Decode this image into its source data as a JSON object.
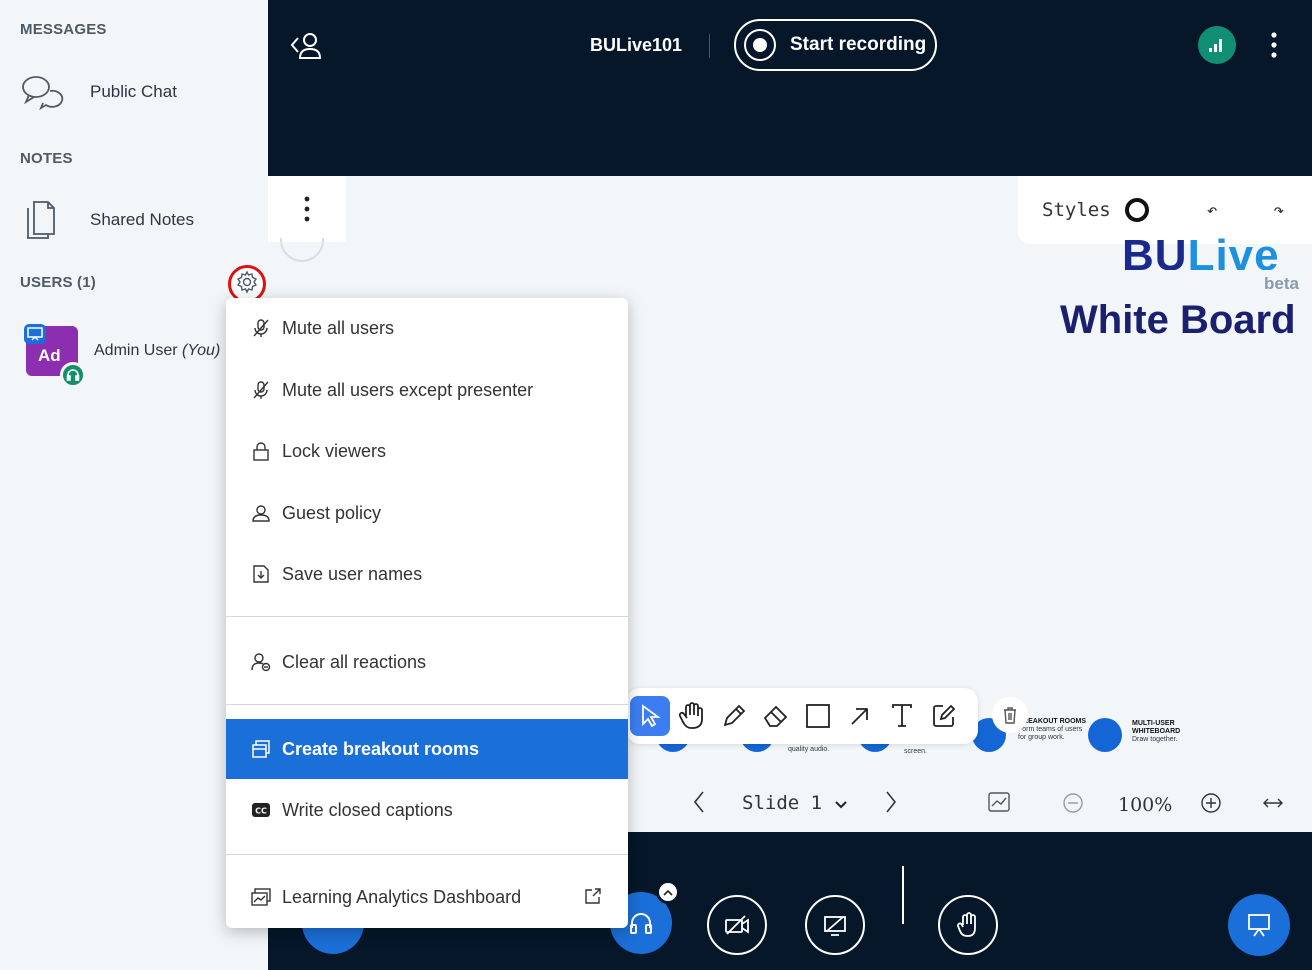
{
  "sidebar": {
    "messages_title": "MESSAGES",
    "public_chat": "Public Chat",
    "notes_title": "NOTES",
    "shared_notes": "Shared Notes",
    "users_title": "USERS (1)",
    "user": {
      "initials": "Ad",
      "name": "Admin User",
      "you_suffix": "(You)"
    }
  },
  "topbar": {
    "meeting_name": "BULive101",
    "record_label": "Start recording"
  },
  "presentation": {
    "styles_label": "Styles",
    "logo_bu": "BU",
    "logo_live": "Live",
    "logo_beta": "beta",
    "heading": "White Board",
    "features": [
      {
        "title": "",
        "desc": "quality audio."
      },
      {
        "title": "",
        "desc": "screen."
      },
      {
        "title": "BREAKOUT ROOMS",
        "desc": "Form teams of users for group work."
      },
      {
        "title": "MULTI-USER WHITEBOARD",
        "desc": "Draw together."
      }
    ],
    "slide_label": "Slide 1",
    "zoom_label": "100%"
  },
  "manage_menu": {
    "items": [
      {
        "label": "Mute all users",
        "icon": "mic-off-icon"
      },
      {
        "label": "Mute all users except presenter",
        "icon": "mic-off-icon"
      },
      {
        "label": "Lock viewers",
        "icon": "lock-icon"
      },
      {
        "label": "Guest policy",
        "icon": "user-icon"
      },
      {
        "label": "Save user names",
        "icon": "download-file-icon"
      },
      {
        "label": "Clear all reactions",
        "icon": "user-clear-icon"
      },
      {
        "label": "Create breakout rooms",
        "icon": "breakout-icon"
      },
      {
        "label": "Write closed captions",
        "icon": "cc-icon"
      },
      {
        "label": "Learning Analytics Dashboard",
        "icon": "analytics-icon"
      }
    ]
  },
  "colors": {
    "dark_bg": "#06172a",
    "accent_blue": "#1a70d8",
    "avatar_purple": "#8b2eb0",
    "connection_green": "#118f74",
    "highlight_red": "#e01010"
  }
}
